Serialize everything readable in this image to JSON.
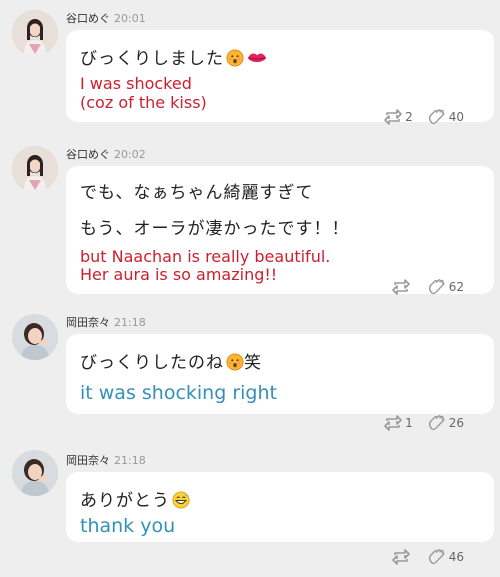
{
  "messages": [
    {
      "author": "谷口めぐ",
      "time": "20:01",
      "jp_lines": [
        "びっくりしました"
      ],
      "translation": [
        "I was shocked",
        "(coz of the kiss)"
      ],
      "retweets": "2",
      "likes": "40",
      "emoji": [
        "shocked-face-emoji",
        "kiss-lips-emoji"
      ]
    },
    {
      "author": "谷口めぐ",
      "time": "20:02",
      "jp_lines": [
        "でも、なぁちゃん綺麗すぎて",
        "もう、オーラが凄かったです！！"
      ],
      "translation": [
        "but Naachan is really beautiful.",
        "Her aura is so amazing!!"
      ],
      "retweets": "",
      "likes": "62"
    },
    {
      "author": "岡田奈々",
      "time": "21:18",
      "jp_lines": [
        "びっくりしたのね",
        "笑"
      ],
      "translation": [
        "it was shocking right"
      ],
      "retweets": "1",
      "likes": "26",
      "emoji": [
        "shocked-face-emoji"
      ]
    },
    {
      "author": "岡田奈々",
      "time": "21:18",
      "jp_lines": [
        "ありがとう"
      ],
      "translation": [
        "thank you"
      ],
      "retweets": "",
      "likes": "46",
      "emoji": [
        "grinning-face-emoji"
      ]
    }
  ],
  "colors": {
    "background": "#eeeeee",
    "bubble": "#ffffff",
    "translation_red": "#cc1f2e",
    "translation_blue": "#3590b8"
  }
}
